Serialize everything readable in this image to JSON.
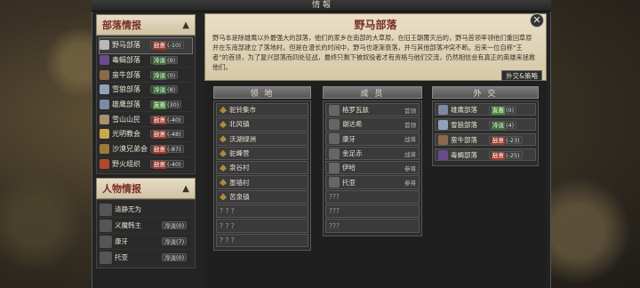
{
  "window": {
    "title": "情 報"
  },
  "left": {
    "tribes_header": "部落情报",
    "tribes": [
      {
        "name": "野马部落",
        "status": "敌意",
        "status_type": "hostile",
        "value": "-10",
        "color": "#b8b8b8"
      },
      {
        "name": "毒蝎部落",
        "status": "冷淡",
        "status_type": "neutral",
        "value": "9",
        "color": "#6a4b8c"
      },
      {
        "name": "蛮牛部落",
        "status": "冷淡",
        "status_type": "neutral",
        "value": "0",
        "color": "#8a6a4a"
      },
      {
        "name": "雪狼部落",
        "status": "冷淡",
        "status_type": "neutral",
        "value": "8",
        "color": "#8fa2b8"
      },
      {
        "name": "雄鹰部落",
        "status": "友善",
        "status_type": "friendly",
        "value": "30",
        "color": "#7a8aa6"
      },
      {
        "name": "雪山山民",
        "status": "敌意",
        "status_type": "hostile",
        "value": "-40",
        "color": "#aa9070"
      },
      {
        "name": "光明教会",
        "status": "敌意",
        "status_type": "hostile",
        "value": "-48",
        "color": "#c9a94a"
      },
      {
        "name": "沙漠兄弟会",
        "status": "敌意",
        "status_type": "hostile",
        "value": "-87",
        "color": "#9a7b3a"
      },
      {
        "name": "野火组织",
        "status": "敌意",
        "status_type": "hostile",
        "value": "-40",
        "color": "#b04a2a"
      }
    ],
    "chars_header": "人物情报",
    "chars": [
      {
        "name": "清静无为",
        "status": ""
      },
      {
        "name": "义魔韩主",
        "status": "冷淡(0)"
      },
      {
        "name": "康牙",
        "status": "冷淡(7)"
      },
      {
        "name": "托亚",
        "status": "冷淡(0)"
      }
    ]
  },
  "detail": {
    "title": "野马部落",
    "description": "野马本是除雄鹰以外最强大的部落，他们的家乡在南部的大草原，在旧王朝覆灭后的，野马首领率领他们重回草原并在东南部建立了落地村。但是在漫长的时间中，野马也逐渐衰落，并与其他部落冲突不断。后来一位自称“王者”的首领，为了复兴部落而四处征战，最终只剩下被奴役者才有资格与他们交流，仍然相信会有真正的英雄来拯救他们。",
    "diplomacy_button": "外交&策略",
    "territory_header": "领 地",
    "territory": [
      "驼铃集市",
      "北风镇",
      "沃湖绿洲",
      "驼峰营",
      "泉谷村",
      "墨墙村",
      "苦泉镇",
      "? ? ?",
      "? ? ?",
      "? ? ?"
    ],
    "members_header": "成 员",
    "members": [
      {
        "name": "格罗瓦兹",
        "role": "首领"
      },
      {
        "name": "谢达希",
        "role": "首领"
      },
      {
        "name": "康牙",
        "role": "战将"
      },
      {
        "name": "金足赤",
        "role": "战将"
      },
      {
        "name": "伊哈",
        "role": "参将"
      },
      {
        "name": "托亚",
        "role": "参将"
      }
    ],
    "members_unknown": [
      "???",
      "???",
      "???"
    ],
    "diplo_header": "外 交",
    "diplomacy": [
      {
        "name": "雄鹰部落",
        "status": "友善",
        "status_type": "friendly",
        "value": "0"
      },
      {
        "name": "雪狼部落",
        "status": "冷淡",
        "status_type": "neutral",
        "value": "4"
      },
      {
        "name": "蛮牛部落",
        "status": "敌意",
        "status_type": "hostile",
        "value": "-23"
      },
      {
        "name": "毒蝎部落",
        "status": "敌意",
        "status_type": "hostile",
        "value": "-25"
      }
    ]
  },
  "icons": {
    "close": "close-icon",
    "chevron": "chevron-up-icon"
  }
}
